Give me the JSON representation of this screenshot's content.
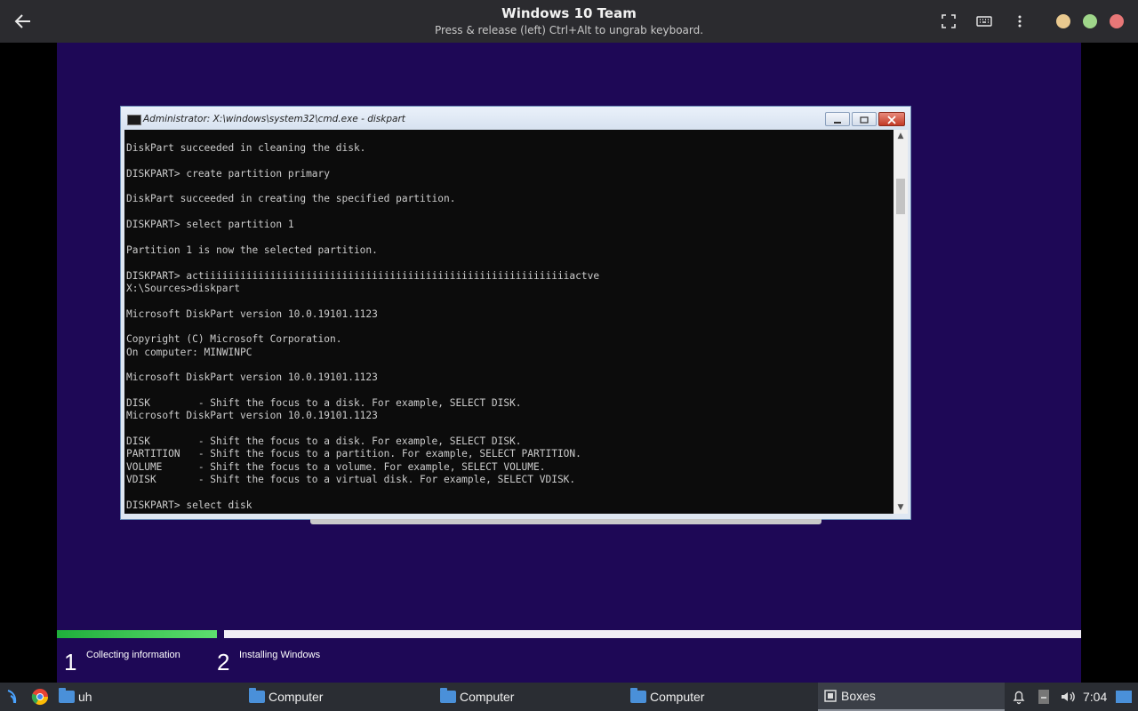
{
  "header": {
    "title": "Windows 10 Team",
    "subtitle": "Press & release (left) Ctrl+Alt to ungrab keyboard."
  },
  "cmd": {
    "title": "Administrator: X:\\windows\\system32\\cmd.exe - diskpart",
    "lines": [
      "DiskPart succeeded in cleaning the disk.",
      "",
      "DISKPART> create partition primary",
      "",
      "DiskPart succeeded in creating the specified partition.",
      "",
      "DISKPART> select partition 1",
      "",
      "Partition 1 is now the selected partition.",
      "",
      "DISKPART> actiiiiiiiiiiiiiiiiiiiiiiiiiiiiiiiiiiiiiiiiiiiiiiiiiiiiiiiiiiiiiactve",
      "X:\\Sources>diskpart",
      "",
      "Microsoft DiskPart version 10.0.19101.1123",
      "",
      "Copyright (C) Microsoft Corporation.",
      "On computer: MINWINPC",
      "",
      "Microsoft DiskPart version 10.0.19101.1123",
      "",
      "DISK        - Shift the focus to a disk. For example, SELECT DISK.",
      "Microsoft DiskPart version 10.0.19101.1123",
      "",
      "DISK        - Shift the focus to a disk. For example, SELECT DISK.",
      "PARTITION   - Shift the focus to a partition. For example, SELECT PARTITION.",
      "VOLUME      - Shift the focus to a volume. For example, SELECT VOLUME.",
      "VDISK       - Shift the focus to a virtual disk. For example, SELECT VDISK.",
      "",
      "DISKPART> select disk"
    ]
  },
  "setup": {
    "progress_fraction": 0.16,
    "steps": [
      {
        "num": "1",
        "label": "Collecting information"
      },
      {
        "num": "2",
        "label": "Installing Windows"
      }
    ]
  },
  "taskbar": {
    "items": [
      "uh",
      "Computer",
      "Computer",
      "Computer",
      "Boxes"
    ],
    "clock": "7:04"
  },
  "colors": {
    "vm_background": "#1e0856",
    "progress_green": "#3cc24f",
    "header_bg": "#2b2b2f",
    "dot_yellow": "#e9c98f",
    "dot_green": "#9fd68a",
    "dot_red": "#e87777"
  }
}
